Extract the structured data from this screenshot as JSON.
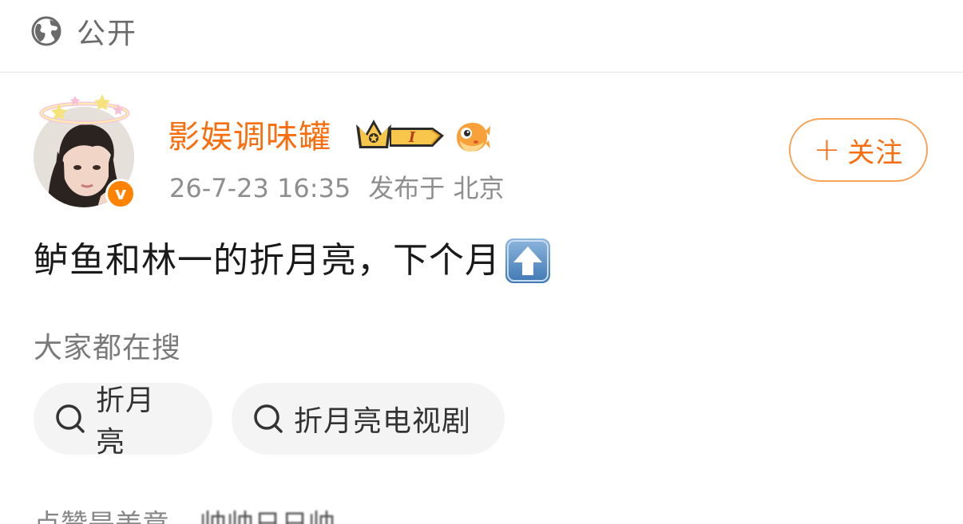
{
  "visibility": {
    "icon": "globe-icon",
    "label": "公开"
  },
  "author": {
    "name": "影娱调味罐",
    "verified_icon": "verified-v-badge",
    "verified_letter": "v",
    "level_icon": "crown-level-badge",
    "level_text": "I",
    "fan_icon": "pufferfish-icon",
    "accent": "#f86e0e"
  },
  "meta": {
    "time": "26-7-23 16:35",
    "location": "发布于 北京"
  },
  "follow_button": {
    "plus": "+",
    "label": "关注"
  },
  "post": {
    "text": "鲈鱼和林一的折月亮，下个月",
    "emoji": "up-arrow-emoji"
  },
  "search_section": {
    "heading": "大家都在搜",
    "chips": [
      {
        "label": "折月亮",
        "icon": "search-icon"
      },
      {
        "label": "折月亮电视剧",
        "icon": "search-icon"
      }
    ]
  },
  "bottom_partial": {
    "text": "点赞是美意",
    "blurred": "帅帅日日帅"
  }
}
